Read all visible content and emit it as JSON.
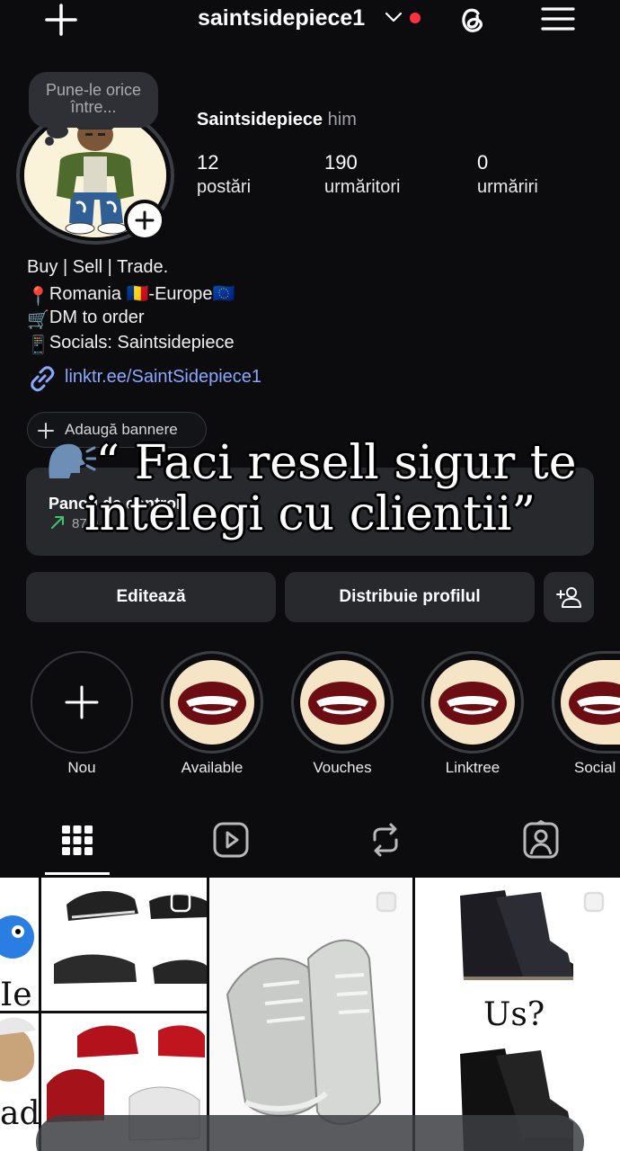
{
  "header": {
    "username": "saintsidepiece1",
    "icons": [
      "plus-icon",
      "chevron-down-icon",
      "threads-icon",
      "hamburger-menu-icon"
    ],
    "notification_dot_color": "#ff3040"
  },
  "note": {
    "text": "Pune-le orice între..."
  },
  "profile": {
    "display_name": "Saintsidepiece",
    "pronouns": "him",
    "stats": [
      {
        "value": "12",
        "label": "postări"
      },
      {
        "value": "190",
        "label": "urmăritori"
      },
      {
        "value": "0",
        "label": "urmăriri"
      }
    ]
  },
  "bio": {
    "lines": [
      {
        "emoji": "",
        "text": "Buy | Sell | Trade."
      },
      {
        "emoji": "📍",
        "text": "Romania 🇷🇴-Europe🇪🇺"
      },
      {
        "emoji": "🛒",
        "text": "DM to order"
      },
      {
        "emoji": "📱",
        "text": "Socials: Saintsidepiece"
      }
    ],
    "link": "linktr.ee/SaintSidepiece1",
    "link_color": "#8aa8ff"
  },
  "banner_chip": {
    "label": "Adaugă bannere"
  },
  "dashboard": {
    "title": "Panou de control",
    "subtitle": "87,9"
  },
  "caption": {
    "line1": "“ Faci resell sigur te",
    "line2": "intelegi cu clientii”"
  },
  "actions": {
    "edit": "Editează",
    "share": "Distribuie profilul"
  },
  "highlights": [
    {
      "label": "Nou"
    },
    {
      "label": "Available"
    },
    {
      "label": "Vouches"
    },
    {
      "label": "Linktree"
    },
    {
      "label": "Social"
    }
  ],
  "tabs": [
    "grid-tab",
    "reels-tab",
    "reposts-tab",
    "tagged-tab"
  ],
  "grid_posts": [
    {
      "text": "Ie"
    },
    {
      "text": "ad"
    },
    {
      "text": "Us?"
    }
  ]
}
